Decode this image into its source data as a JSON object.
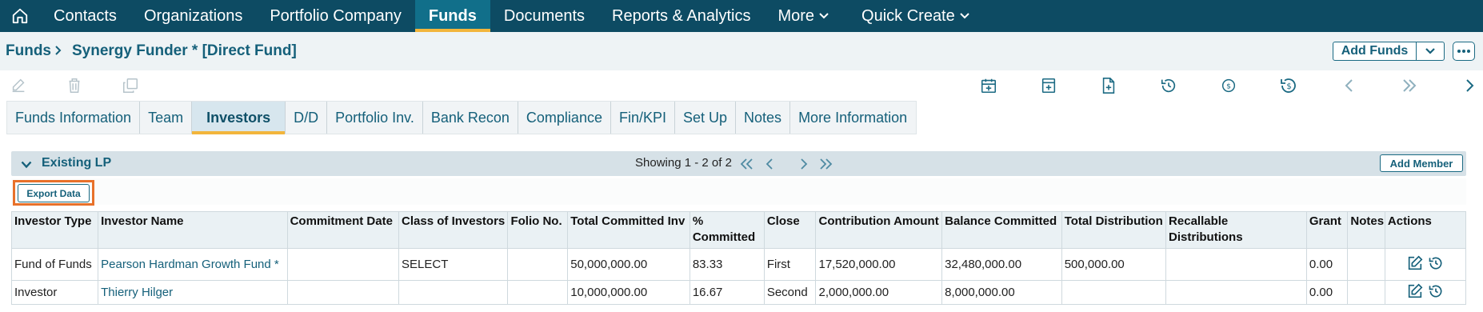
{
  "nav": {
    "items": [
      {
        "label": "Contacts"
      },
      {
        "label": "Organizations"
      },
      {
        "label": "Portfolio Company"
      },
      {
        "label": "Funds"
      },
      {
        "label": "Documents"
      },
      {
        "label": "Reports & Analytics"
      },
      {
        "label": "More"
      },
      {
        "label": "Quick Create"
      }
    ],
    "active_index": 3
  },
  "breadcrumb": {
    "root": "Funds",
    "current": "Synergy Funder * [Direct Fund]"
  },
  "header_actions": {
    "add_funds_label": "Add Funds"
  },
  "tabs": [
    {
      "label": "Funds Information"
    },
    {
      "label": "Team"
    },
    {
      "label": "Investors"
    },
    {
      "label": "D/D"
    },
    {
      "label": "Portfolio Inv."
    },
    {
      "label": "Bank Recon"
    },
    {
      "label": "Compliance"
    },
    {
      "label": "Fin/KPI"
    },
    {
      "label": "Set Up"
    },
    {
      "label": "Notes"
    },
    {
      "label": "More Information"
    }
  ],
  "active_tab_index": 2,
  "section": {
    "title": "Existing LP",
    "paging_text": "Showing 1 - 2 of 2",
    "add_member_label": "Add Member"
  },
  "export_label": "Export Data",
  "table": {
    "columns": [
      "Investor Type",
      "Investor Name",
      "Commitment Date",
      "Class of Investors",
      "Folio No.",
      "Total Committed Inv",
      "% Committed",
      "Close",
      "Contribution Amount",
      "Balance Committed",
      "Total Distribution",
      "Recallable Distributions",
      "Grant",
      "Notes",
      "Actions"
    ],
    "rows": [
      {
        "investor_type": "Fund of Funds",
        "investor_name": "Pearson Hardman Growth Fund *",
        "commitment_date": "",
        "class_of_investors": "SELECT",
        "folio_no": "",
        "total_committed_inv": "50,000,000.00",
        "pct_committed": "83.33",
        "close": "First",
        "contribution_amount": "17,520,000.00",
        "balance_committed": "32,480,000.00",
        "total_distribution": "500,000.00",
        "recallable_distributions": "",
        "grant": "0.00",
        "notes": ""
      },
      {
        "investor_type": "Investor",
        "investor_name": "Thierry Hilger",
        "commitment_date": "",
        "class_of_investors": "",
        "folio_no": "",
        "total_committed_inv": "10,000,000.00",
        "pct_committed": "16.67",
        "close": "Second",
        "contribution_amount": "2,000,000.00",
        "balance_committed": "8,000,000.00",
        "total_distribution": "",
        "recallable_distributions": "",
        "grant": "0.00",
        "notes": ""
      }
    ]
  },
  "icons": {
    "home": "home-icon",
    "toolbar_left": [
      "edit-icon",
      "trash-icon",
      "copy-icon"
    ],
    "toolbar_right": [
      "calendar-plus-icon",
      "ledger-icon",
      "file-plus-icon",
      "history-icon",
      "coin-icon",
      "coin-history-icon",
      "chevron-left-icon",
      "double-chevron-right-icon",
      "chevron-right-icon"
    ],
    "row_actions": [
      "edit-icon",
      "history-icon"
    ]
  },
  "colors": {
    "nav_bg": "#0d4b63",
    "nav_active": "#116f8a",
    "accent_underline": "#f2b53c",
    "link": "#15607a",
    "highlight_outline": "#e8712a"
  }
}
